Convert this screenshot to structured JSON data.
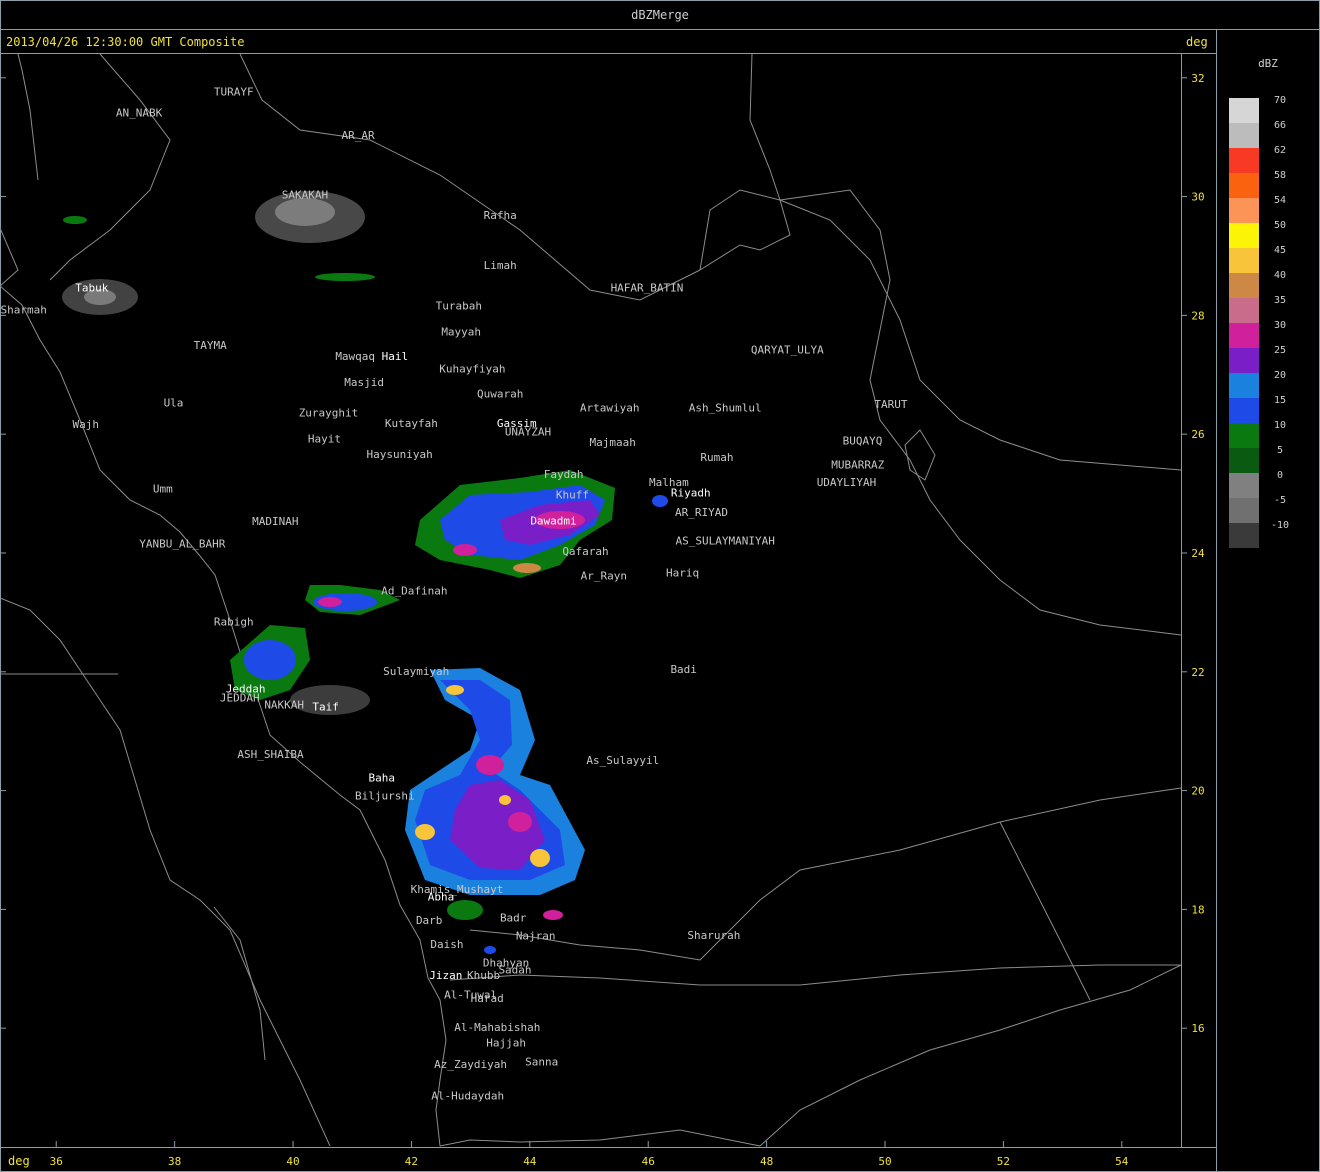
{
  "window": {
    "title": "dBZMerge"
  },
  "header": {
    "caption": "2013/04/26 12:30:00 GMT Composite",
    "unit_right": "deg"
  },
  "footer": {
    "unit_left": "deg"
  },
  "axes": {
    "lon_ticks": [
      36,
      38,
      40,
      42,
      44,
      46,
      48,
      50,
      52,
      54
    ],
    "lat_ticks": [
      32,
      30,
      28,
      26,
      24,
      22,
      20,
      18,
      16
    ],
    "lon_range": [
      35.05,
      55.0
    ],
    "lat_range": [
      14.0,
      32.4
    ]
  },
  "legend": {
    "title": "dBZ",
    "entries": [
      {
        "label": "70",
        "color": "#d6d6d6"
      },
      {
        "label": "66",
        "color": "#bcbcbc"
      },
      {
        "label": "62",
        "color": "#f83a25"
      },
      {
        "label": "58",
        "color": "#fb6210"
      },
      {
        "label": "54",
        "color": "#fc9458"
      },
      {
        "label": "50",
        "color": "#fbf407"
      },
      {
        "label": "45",
        "color": "#f7c43a"
      },
      {
        "label": "40",
        "color": "#cc8844"
      },
      {
        "label": "35",
        "color": "#c96c8c"
      },
      {
        "label": "30",
        "color": "#d0209b"
      },
      {
        "label": "25",
        "color": "#7a1ec8"
      },
      {
        "label": "20",
        "color": "#1a82de"
      },
      {
        "label": "15",
        "color": "#1e4ae8"
      },
      {
        "label": "10",
        "color": "#0a7a10"
      },
      {
        "label": "5",
        "color": "#0b5a12"
      },
      {
        "label": "0",
        "color": "#808080"
      },
      {
        "label": "-5",
        "color": "#707070"
      },
      {
        "label": "-10",
        "color": "#3a3a3a"
      }
    ]
  },
  "cities": [
    {
      "name": "TURAYF",
      "lon": 39.0,
      "lat": 31.7
    },
    {
      "name": "AN_NABK",
      "lon": 37.4,
      "lat": 31.35
    },
    {
      "name": "AR_AR",
      "lon": 41.1,
      "lat": 30.97
    },
    {
      "name": "SAKAKAH",
      "lon": 40.2,
      "lat": 29.97
    },
    {
      "name": "Rafha",
      "lon": 43.5,
      "lat": 29.62
    },
    {
      "name": "Limah",
      "lon": 43.5,
      "lat": 28.78
    },
    {
      "name": "HAFAR_BATIN",
      "lon": 45.98,
      "lat": 28.4
    },
    {
      "name": "Turabah",
      "lon": 42.8,
      "lat": 28.1
    },
    {
      "name": "Mayyah",
      "lon": 42.84,
      "lat": 27.66
    },
    {
      "name": "QARYAT_ULYA",
      "lon": 48.35,
      "lat": 27.36
    },
    {
      "name": "TAYMA",
      "lon": 38.6,
      "lat": 27.43
    },
    {
      "name": "Mawqaq",
      "lon": 41.05,
      "lat": 27.25
    },
    {
      "name": "Hail",
      "lon": 41.72,
      "lat": 27.25
    },
    {
      "name": "Kuhayfiyah",
      "lon": 43.03,
      "lat": 27.04
    },
    {
      "name": "Masjid",
      "lon": 41.2,
      "lat": 26.81
    },
    {
      "name": "Quwarah",
      "lon": 43.5,
      "lat": 26.62
    },
    {
      "name": "Ula",
      "lon": 37.98,
      "lat": 26.47
    },
    {
      "name": "Artawiyah",
      "lon": 45.35,
      "lat": 26.38
    },
    {
      "name": "Ash_Shumlul",
      "lon": 47.3,
      "lat": 26.38
    },
    {
      "name": "TARUT",
      "lon": 50.1,
      "lat": 26.44
    },
    {
      "name": "Zurayghit",
      "lon": 40.6,
      "lat": 26.3
    },
    {
      "name": "Kutayfah",
      "lon": 42.0,
      "lat": 26.12
    },
    {
      "name": "Gassim",
      "lon": 43.78,
      "lat": 26.12
    },
    {
      "name": "UNAYZAH",
      "lon": 43.97,
      "lat": 25.98
    },
    {
      "name": "Wajh",
      "lon": 36.5,
      "lat": 26.1
    },
    {
      "name": "Hayit",
      "lon": 40.53,
      "lat": 25.86
    },
    {
      "name": "Majmaah",
      "lon": 45.4,
      "lat": 25.8
    },
    {
      "name": "BUQAYQ",
      "lon": 49.62,
      "lat": 25.83
    },
    {
      "name": "Haysuniyah",
      "lon": 41.8,
      "lat": 25.6
    },
    {
      "name": "Rumah",
      "lon": 47.16,
      "lat": 25.55
    },
    {
      "name": "MUBARRAZ",
      "lon": 49.54,
      "lat": 25.42
    },
    {
      "name": "Faydah",
      "lon": 44.57,
      "lat": 25.26
    },
    {
      "name": "UDAYLIYAH",
      "lon": 49.35,
      "lat": 25.13
    },
    {
      "name": "Malham",
      "lon": 46.35,
      "lat": 25.13
    },
    {
      "name": "Umm",
      "lon": 37.8,
      "lat": 25.02
    },
    {
      "name": "Riyadh",
      "lon": 46.72,
      "lat": 24.95
    },
    {
      "name": "Khuff",
      "lon": 44.72,
      "lat": 24.92
    },
    {
      "name": "AR_RIYAD",
      "lon": 46.9,
      "lat": 24.62
    },
    {
      "name": "Dawadmi",
      "lon": 44.4,
      "lat": 24.48
    },
    {
      "name": "MADINAH",
      "lon": 39.7,
      "lat": 24.47
    },
    {
      "name": "YANBU_AL_BAHR",
      "lon": 38.13,
      "lat": 24.09
    },
    {
      "name": "AS_SULAYMANIYAH",
      "lon": 47.3,
      "lat": 24.14
    },
    {
      "name": "Qafarah",
      "lon": 44.94,
      "lat": 23.97
    },
    {
      "name": "Hariq",
      "lon": 46.58,
      "lat": 23.6
    },
    {
      "name": "Ar_Rayn",
      "lon": 45.25,
      "lat": 23.55
    },
    {
      "name": "Ad_Dafinah",
      "lon": 42.05,
      "lat": 23.3
    },
    {
      "name": "Rabigh",
      "lon": 39.0,
      "lat": 22.78
    },
    {
      "name": "Badi",
      "lon": 46.6,
      "lat": 21.98
    },
    {
      "name": "Sulaymiyah",
      "lon": 42.08,
      "lat": 21.95
    },
    {
      "name": "Jeddah",
      "lon": 39.2,
      "lat": 21.65
    },
    {
      "name": "JEDDAH",
      "lon": 39.1,
      "lat": 21.5
    },
    {
      "name": "NAKKAH",
      "lon": 39.85,
      "lat": 21.38
    },
    {
      "name": "Taif",
      "lon": 40.55,
      "lat": 21.35
    },
    {
      "name": "ASH_SHAIBA",
      "lon": 39.62,
      "lat": 20.55
    },
    {
      "name": "As_Sulayyil",
      "lon": 45.57,
      "lat": 20.45
    },
    {
      "name": "Baha",
      "lon": 41.5,
      "lat": 20.15
    },
    {
      "name": "Biljurshi",
      "lon": 41.55,
      "lat": 19.85
    },
    {
      "name": "Khamis_Mushayt",
      "lon": 42.77,
      "lat": 18.28
    },
    {
      "name": "Abha",
      "lon": 42.5,
      "lat": 18.15
    },
    {
      "name": "Badr",
      "lon": 43.72,
      "lat": 17.8
    },
    {
      "name": "Darb",
      "lon": 42.3,
      "lat": 17.75
    },
    {
      "name": "Najran",
      "lon": 44.1,
      "lat": 17.49
    },
    {
      "name": "Sharurah",
      "lon": 47.11,
      "lat": 17.5
    },
    {
      "name": "Daish",
      "lon": 42.6,
      "lat": 17.35
    },
    {
      "name": "Dhahyan",
      "lon": 43.6,
      "lat": 17.04
    },
    {
      "name": "Sadah",
      "lon": 43.75,
      "lat": 16.92
    },
    {
      "name": "Jizan",
      "lon": 42.58,
      "lat": 16.83
    },
    {
      "name": "Khubb",
      "lon": 43.22,
      "lat": 16.83
    },
    {
      "name": "Al-Tuwal",
      "lon": 43.0,
      "lat": 16.5
    },
    {
      "name": "Harad",
      "lon": 43.28,
      "lat": 16.44
    },
    {
      "name": "Al-Mahabishah",
      "lon": 43.45,
      "lat": 15.95
    },
    {
      "name": "Hajjah",
      "lon": 43.6,
      "lat": 15.69
    },
    {
      "name": "Sanna",
      "lon": 44.2,
      "lat": 15.37
    },
    {
      "name": "Az_Zaydiyah",
      "lon": 43.0,
      "lat": 15.33
    },
    {
      "name": "Al-Hudaydah",
      "lon": 42.95,
      "lat": 14.8
    },
    {
      "name": "Sharmah",
      "lon": 35.45,
      "lat": 28.03
    },
    {
      "name": "Tabuk",
      "lon": 36.6,
      "lat": 28.4
    }
  ]
}
